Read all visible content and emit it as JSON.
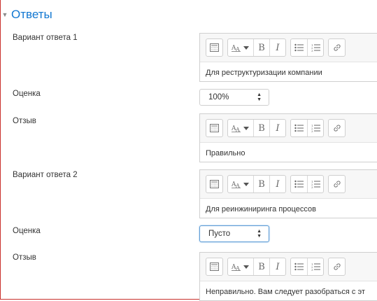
{
  "section": {
    "title": "Ответы"
  },
  "toolbar_icons": [
    "toolbar-toggle-icon",
    "font-style-icon",
    "bold-icon",
    "italic-icon",
    "bullet-list-icon",
    "numbered-list-icon",
    "link-icon"
  ],
  "toolbar_labels": {
    "bold": "B",
    "italic": "I"
  },
  "answers": [
    {
      "answer_label": "Вариант ответа 1",
      "answer_text": "Для реструктуризации компании",
      "grade_label": "Оценка",
      "grade_value": "100%",
      "feedback_label": "Отзыв",
      "feedback_text": "Правильно"
    },
    {
      "answer_label": "Вариант ответа 2",
      "answer_text": "Для реинжиниринга процессов",
      "grade_label": "Оценка",
      "grade_value": "Пусто",
      "feedback_label": "Отзыв",
      "feedback_text": "Неправильно. Вам следует разобраться с эт"
    }
  ],
  "colors": {
    "title": "#1177d1",
    "frame": "#c9302c",
    "focus": "#5b9bd5"
  }
}
